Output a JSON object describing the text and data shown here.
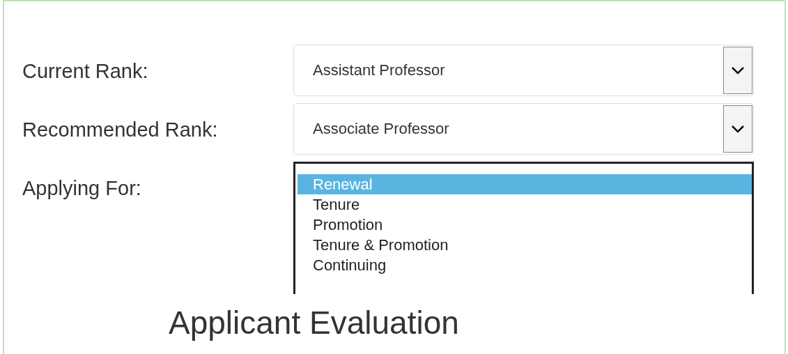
{
  "fields": [
    {
      "label": "Current Rank:",
      "kind": "select",
      "value": "Assistant Professor"
    },
    {
      "label": "Recommended Rank:",
      "kind": "select",
      "value": "Associate Professor"
    },
    {
      "label": "Applying For:",
      "kind": "listbox",
      "options": [
        {
          "text": "Renewal",
          "selected": true
        },
        {
          "text": "Tenure",
          "selected": false
        },
        {
          "text": "Promotion",
          "selected": false
        },
        {
          "text": "Tenure & Promotion",
          "selected": false
        },
        {
          "text": "Continuing",
          "selected": false
        }
      ]
    }
  ],
  "heading": "Applicant Evaluation"
}
